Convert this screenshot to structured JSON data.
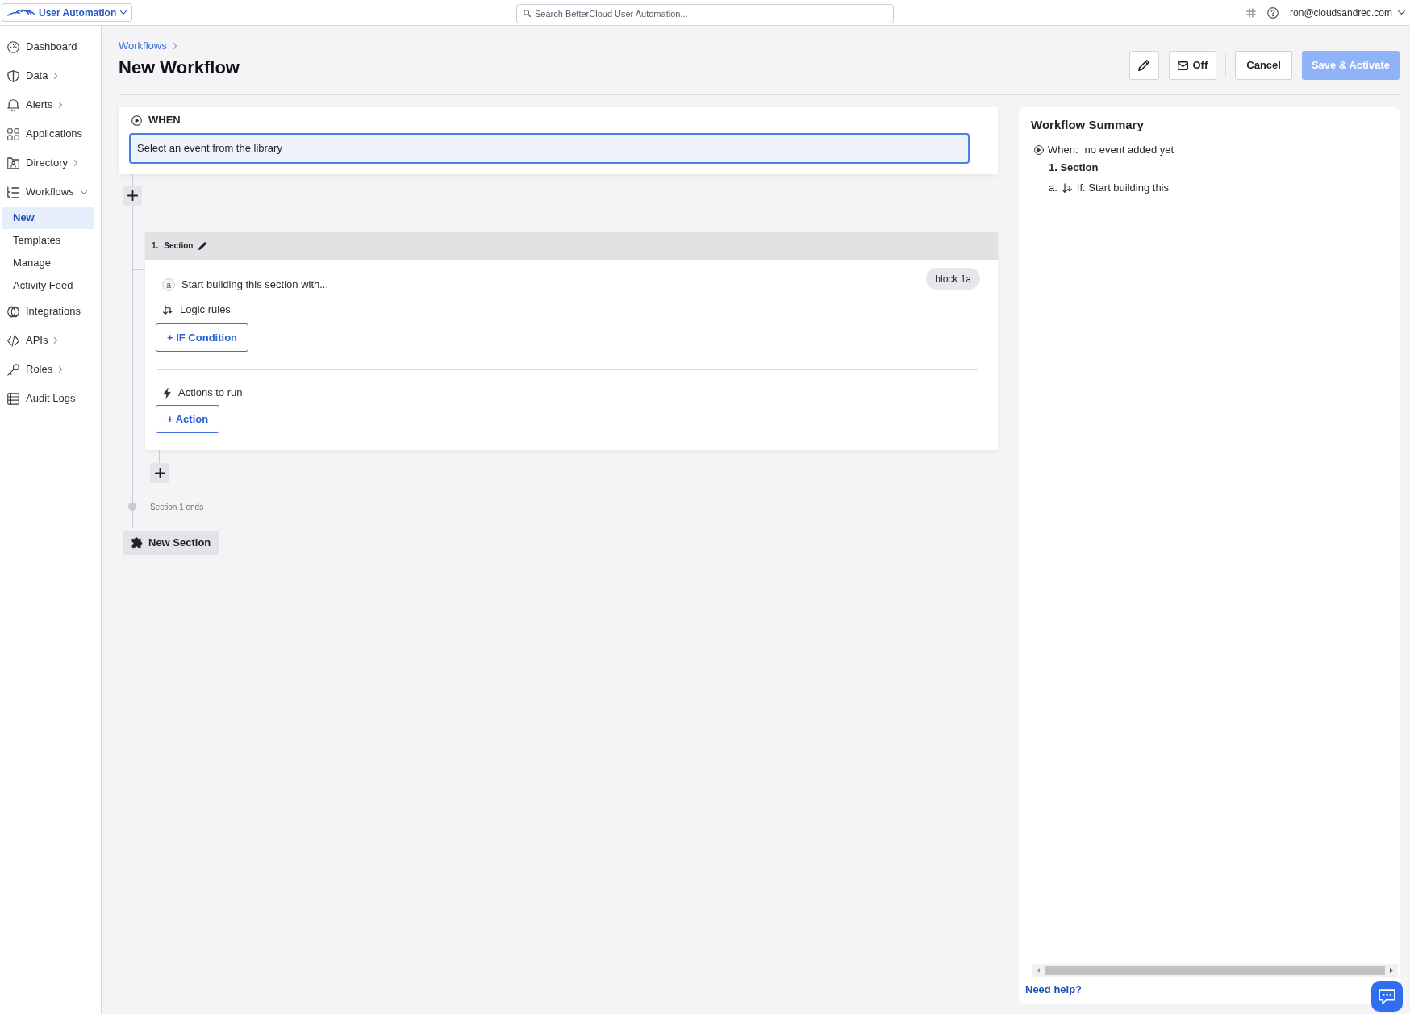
{
  "top_bar": {
    "app_switcher": {
      "label": "User Automation"
    },
    "search": {
      "placeholder": "Search BetterCloud User Automation..."
    },
    "account": {
      "email": "ron@cloudsandrec.com"
    }
  },
  "sidebar": {
    "items": [
      {
        "kind": "link",
        "label": "Dashboard",
        "selected": false
      },
      {
        "kind": "group",
        "label": "Data",
        "expanded": false,
        "selected": false
      },
      {
        "kind": "group",
        "label": "Alerts",
        "expanded": false,
        "selected": false
      },
      {
        "kind": "link",
        "label": "Applications",
        "selected": false
      },
      {
        "kind": "group",
        "label": "Directory",
        "expanded": false,
        "selected": false
      },
      {
        "kind": "group",
        "label": "Workflows",
        "expanded": true,
        "selected": false,
        "children": [
          {
            "label": "New",
            "selected": true
          },
          {
            "label": "Templates",
            "selected": false
          },
          {
            "label": "Manage",
            "selected": false
          },
          {
            "label": "Activity Feed",
            "selected": false
          }
        ]
      },
      {
        "kind": "link",
        "label": "Integrations",
        "selected": false
      },
      {
        "kind": "group",
        "label": "APIs",
        "expanded": false,
        "selected": false
      },
      {
        "kind": "group",
        "label": "Roles",
        "expanded": false,
        "selected": false
      },
      {
        "kind": "link",
        "label": "Audit Logs",
        "selected": false
      }
    ]
  },
  "header": {
    "breadcrumb": [
      "Workflows"
    ],
    "title": "New Workflow",
    "notify_button": {
      "label": "Off"
    },
    "cancel_button": {
      "label": "Cancel"
    },
    "save_button": {
      "label": "Save & Activate",
      "disabled": true
    }
  },
  "trigger": {
    "label": "WHEN",
    "event_field": {
      "label": "Select an event from the library"
    }
  },
  "sections": [
    {
      "number": "1.",
      "title": "Section",
      "blocks": [
        {
          "letter": "a",
          "intro": "Start building this section with...",
          "label": "block 1a",
          "logic_label": "Logic rules",
          "condition_button": "+ IF Condition",
          "actions_label": "Actions to run",
          "action_button": "+ Action"
        }
      ],
      "end_label": "Section 1 ends"
    }
  ],
  "new_section_button": {
    "label": "New Section"
  },
  "summary": {
    "title": "Workflow Summary",
    "when_label": "When:",
    "when_value": "no event added yet",
    "sections": [
      {
        "title": "1. Section",
        "blocks": [
          {
            "marker": "a.",
            "text": "If: Start building this"
          }
        ]
      }
    ],
    "help_link": "Need help?"
  }
}
